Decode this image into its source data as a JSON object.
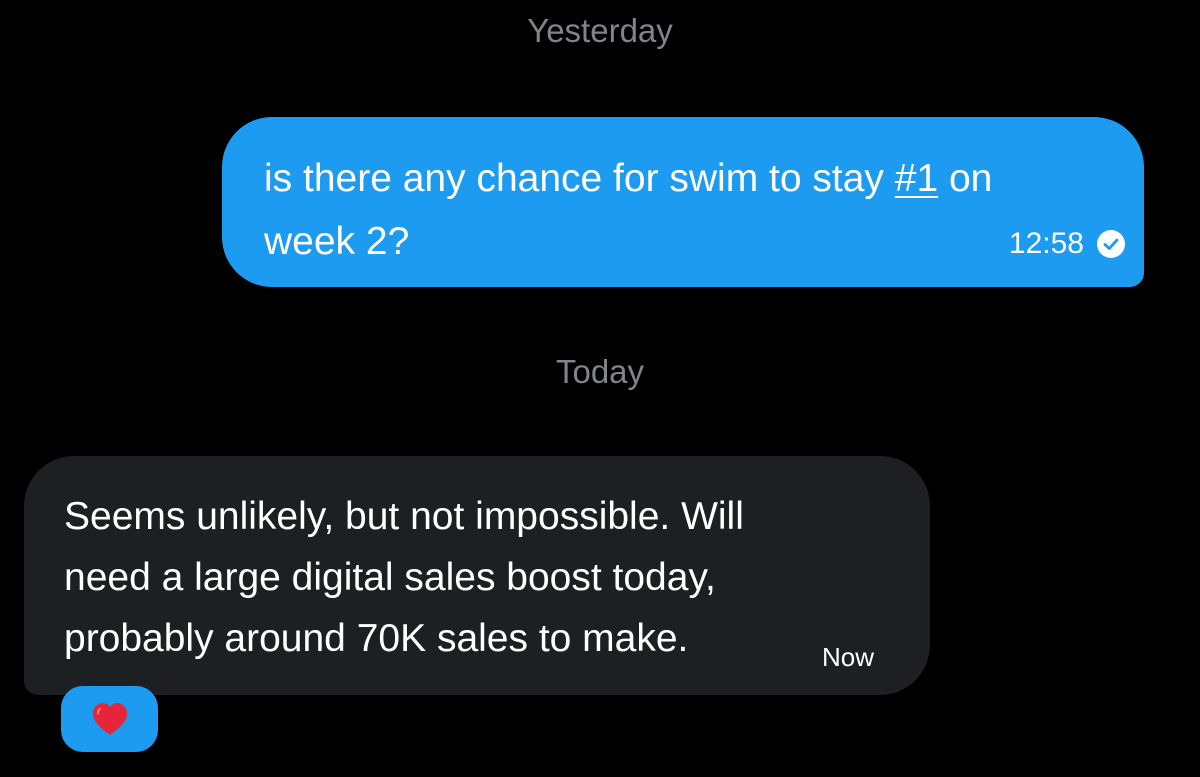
{
  "separators": {
    "yesterday": "Yesterday",
    "today": "Today"
  },
  "sent_message": {
    "line1_before": "is there any chance for swim to stay ",
    "hashtag": "#1",
    "line1_after": " on",
    "line2": "week 2?",
    "time": "12:58",
    "status_icon": "read-check-icon",
    "bubble_color": "#1d9bf0"
  },
  "received_message": {
    "lines": [
      "Seems unlikely, but not impossible. Will",
      "need a large digital sales boost today,",
      "probably around 70K sales to make."
    ],
    "time": "Now",
    "bubble_color": "#1e1f22"
  },
  "reaction": {
    "icon": "red-heart-icon",
    "heart_color": "#e5263a",
    "pill_color": "#1d9bf0"
  }
}
